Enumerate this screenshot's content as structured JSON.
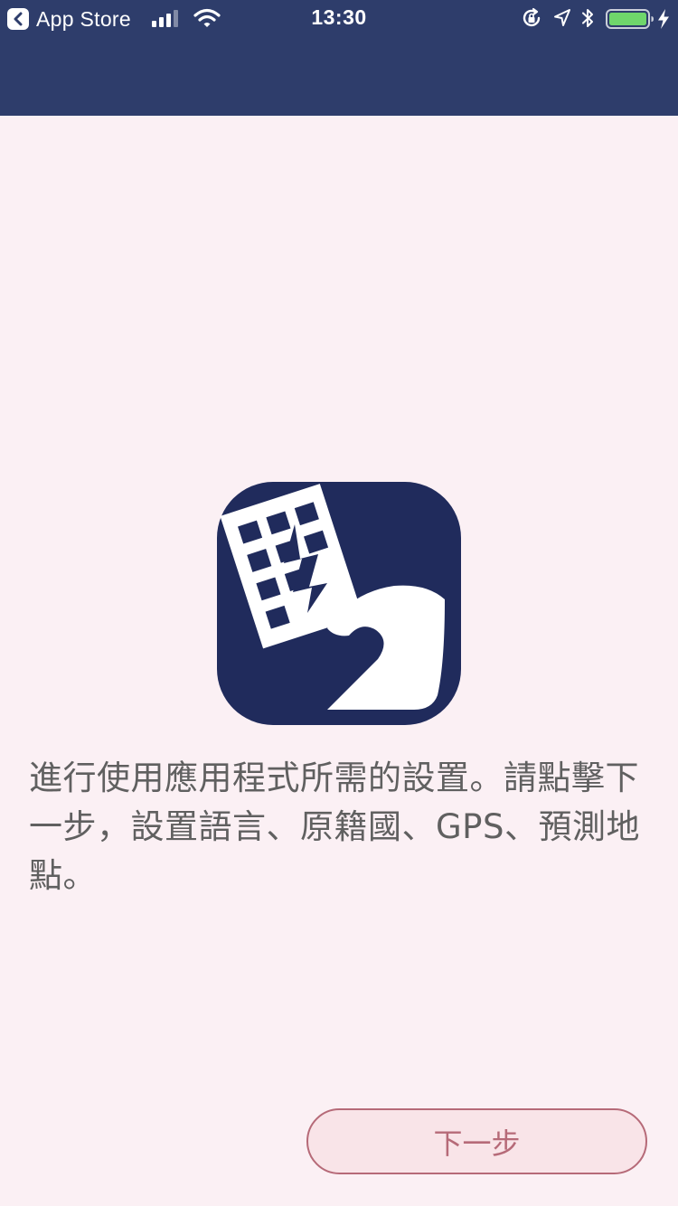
{
  "status_bar": {
    "back_app_label": "App Store",
    "time": "13:30",
    "icons": [
      "back-chevron-icon",
      "signal-icon",
      "wifi-icon",
      "rotation-lock-icon",
      "location-arrow-icon",
      "bluetooth-icon",
      "battery-icon",
      "charging-bolt-icon"
    ],
    "battery_level": 1.0,
    "battery_color": "#6fd66b"
  },
  "header": {
    "background": "#2e3d6b"
  },
  "logo": {
    "icon": "building-tsunami-logo-icon",
    "background": "#202b5c"
  },
  "main": {
    "intro_text": "進行使用應用程式所需的設置。請點擊下一步，設置語言、原籍國、GPS、預測地點。"
  },
  "footer": {
    "next_button_label": "下一步",
    "accent_color": "#b66a78"
  }
}
